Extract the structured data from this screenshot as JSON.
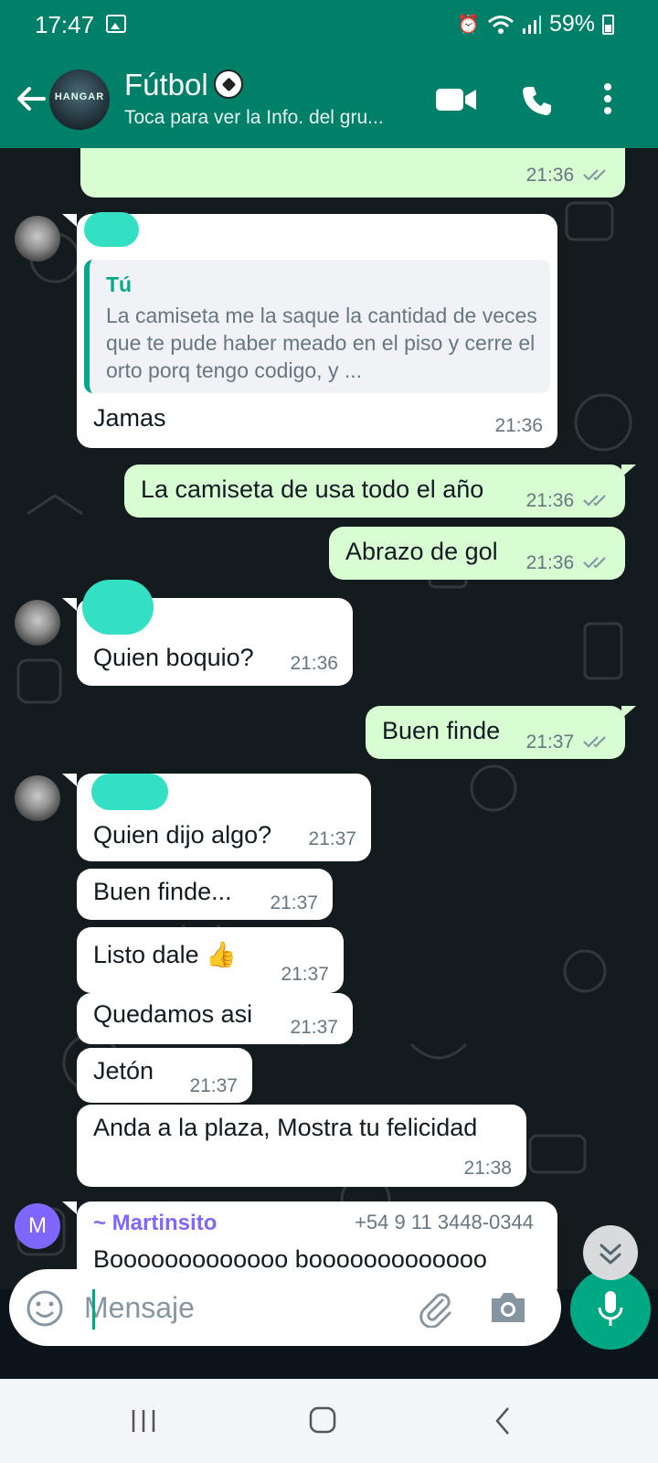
{
  "status_bar": {
    "time": "17:47",
    "battery": "59%"
  },
  "header": {
    "title": "Fútbol",
    "subtitle": "Toca para ver la Info. del gru..."
  },
  "messages": [
    {
      "time": "21:36"
    },
    {
      "quote_author": "Tú",
      "quote_text": "La camiseta me la saque la cantidad de veces que te pude haber meado en el piso y cerre el orto porq tengo codigo, y ...",
      "text": "Jamas",
      "time": "21:36"
    },
    {
      "text": "La camiseta de usa todo el año",
      "time": "21:36"
    },
    {
      "text": "Abrazo de gol",
      "time": "21:36"
    },
    {
      "text": "Quien boquio?",
      "time": "21:36"
    },
    {
      "text": "Buen finde",
      "time": "21:37"
    },
    {
      "text": "Quien dijo algo?",
      "time": "21:37"
    },
    {
      "text": "Buen finde...",
      "time": "21:37"
    },
    {
      "text": "Listo dale",
      "emoji": "👍",
      "time": "21:37"
    },
    {
      "text": "Quedamos asi",
      "time": "21:37"
    },
    {
      "text": "Jetón",
      "time": "21:37"
    },
    {
      "text": "Anda a la plaza, Mostra tu felicidad",
      "time": "21:38"
    },
    {
      "sender": "~ Martinsito",
      "phone": "+54 9 11 3448-0344",
      "text": "Booooooooooooo booooooooooooo",
      "avatar_letter": "M"
    }
  ],
  "composer": {
    "placeholder": "Mensaje"
  },
  "colors": {
    "header": "#008069",
    "outgoing": "#d9fdd3",
    "incoming": "#ffffff",
    "accent": "#00a884",
    "martinsito": "#7f66ff"
  },
  "icons": [
    "back-arrow-icon",
    "video-call-icon",
    "phone-icon",
    "more-vert-icon",
    "emoji-icon",
    "attach-icon",
    "camera-icon",
    "mic-icon",
    "scroll-down-icon",
    "recents-icon",
    "home-icon",
    "nav-back-icon"
  ]
}
